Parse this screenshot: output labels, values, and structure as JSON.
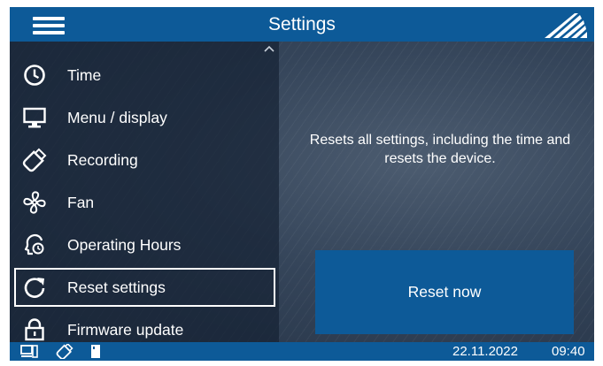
{
  "header": {
    "title": "Settings",
    "menu_icon": "hamburger-menu-icon",
    "logo_icon": "brand-logo-icon"
  },
  "sidebar": {
    "items": [
      {
        "label": "Time",
        "icon": "clock-icon"
      },
      {
        "label": "Menu / display",
        "icon": "monitor-icon"
      },
      {
        "label": "Recording",
        "icon": "usb-stick-icon"
      },
      {
        "label": "Fan",
        "icon": "fan-icon"
      },
      {
        "label": "Operating Hours",
        "icon": "operating-hours-icon"
      },
      {
        "label": "Reset settings",
        "icon": "reset-icon",
        "selected": true
      },
      {
        "label": "Firmware update",
        "icon": "lock-icon"
      }
    ],
    "scroll_up_icon": "chevron-up-icon"
  },
  "main": {
    "description": "Resets all settings, including the time and resets the device.",
    "reset_button_label": "Reset now"
  },
  "statusbar": {
    "icons": [
      "computer-icon",
      "usb-stick-icon",
      "sd-card-icon"
    ],
    "date": "22.11.2022",
    "time": "09:40"
  },
  "colors": {
    "accent_blue": "#0d5a98",
    "background": "#2b3a4e",
    "text": "#ffffff"
  }
}
